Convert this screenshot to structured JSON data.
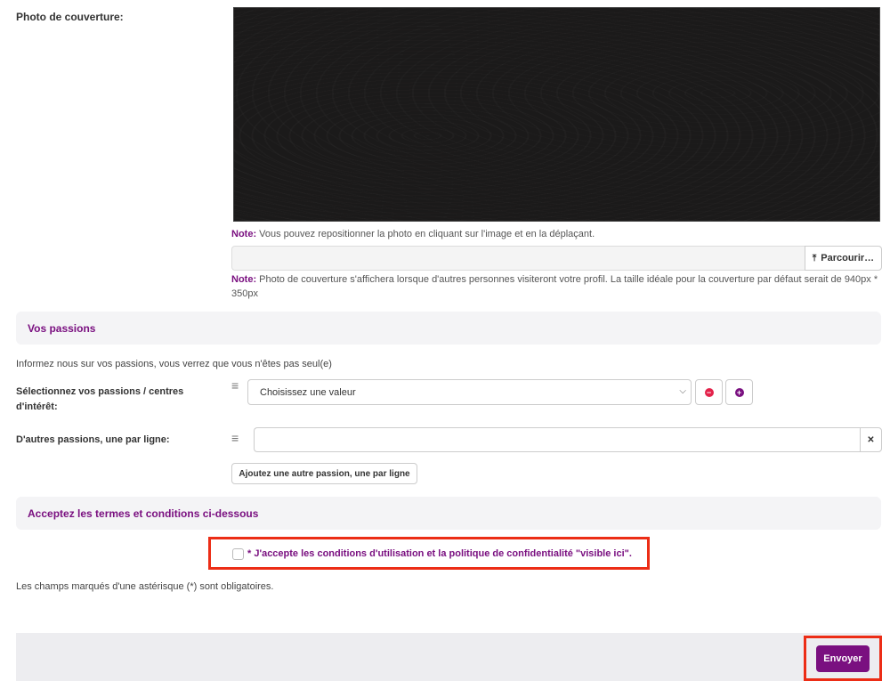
{
  "cover": {
    "label": "Photo de couverture:",
    "note1_bold": "Note:",
    "note1_text": " Vous pouvez repositionner la photo en cliquant sur l'image et en la déplaçant.",
    "browse_label": "Parcourir…",
    "note2_bold": "Note:",
    "note2_text": " Photo de couverture s'affichera lorsque d'autres personnes visiteront votre profil. La taille idéale pour la couverture par défaut serait de 940px * 350px"
  },
  "passions": {
    "section_title": "Vos passions",
    "intro": "Informez nous sur vos passions, vous verrez que vous n'êtes pas seul(e)",
    "select_label": "Sélectionnez vos passions / centres d'intérêt:",
    "select_value": "Choisissez une valeur",
    "other_label": "D'autres passions, une par ligne:",
    "other_value": "",
    "add_button": "Ajoutez une autre passion, une par ligne"
  },
  "terms": {
    "section_title": "Acceptez les termes et conditions ci-dessous",
    "accept_text": "* J'accepte les conditions d'utilisation et la politique de confidentialité \"visible ici\".",
    "required_note": "Les champs marqués d'une astérisque (*) sont obligatoires."
  },
  "submit_label": "Envoyer",
  "colors": {
    "accent": "#7a1080",
    "highlight": "#ec2d16",
    "remove": "#e3224a"
  }
}
